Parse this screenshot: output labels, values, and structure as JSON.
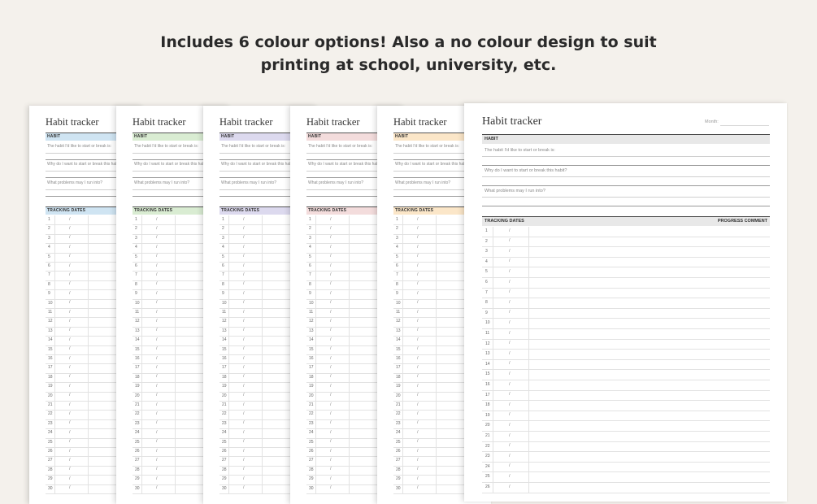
{
  "headline": {
    "line1": "Includes 6 colour options! Also a no colour design to suit",
    "line2": "printing at school, university, etc."
  },
  "sheet": {
    "title": "Habit tracker",
    "habit_label": "HABIT",
    "prompt1": "The habit I'd like to start or break is:",
    "prompt2": "Why do I want to start or break this habit?",
    "prompt3": "What problems may I run into?",
    "tracking_label": "TRACKING DATES",
    "progress_label": "PROGRESS COMMENT",
    "month_label": "Month:",
    "date_separator": "/"
  },
  "colour_options": [
    {
      "name": "blue",
      "color": "#cfe4f2"
    },
    {
      "name": "green",
      "color": "#d9ecd2"
    },
    {
      "name": "purple",
      "color": "#dcd9ee"
    },
    {
      "name": "pink",
      "color": "#f3dcdc"
    },
    {
      "name": "orange",
      "color": "#fbe6c8"
    },
    {
      "name": "no-colour",
      "color": "#e8e8e8"
    }
  ],
  "small_rows": [
    "1",
    "2",
    "3",
    "4",
    "5",
    "6",
    "7",
    "8",
    "9",
    "10",
    "11",
    "12",
    "13",
    "14",
    "15",
    "16",
    "17",
    "18",
    "19",
    "20",
    "21",
    "22",
    "23",
    "24",
    "25",
    "26",
    "27",
    "28",
    "29",
    "30"
  ],
  "large_rows": [
    "1",
    "2",
    "3",
    "4",
    "5",
    "6",
    "7",
    "8",
    "9",
    "10",
    "11",
    "12",
    "13",
    "14",
    "15",
    "16",
    "17",
    "18",
    "19",
    "20",
    "21",
    "22",
    "23",
    "24",
    "25",
    "26"
  ]
}
